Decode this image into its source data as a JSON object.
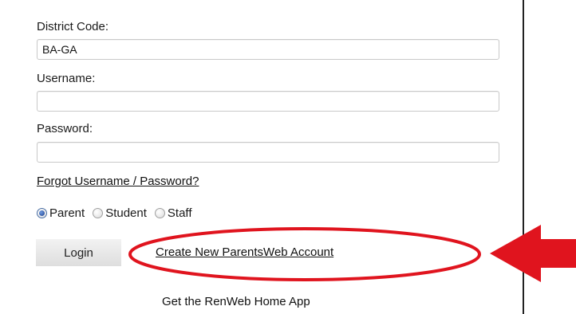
{
  "login_form": {
    "district_code_label": "District Code:",
    "district_code_value": "BA-GA",
    "username_label": "Username:",
    "username_value": "",
    "password_label": "Password:",
    "password_value": "",
    "forgot_link": "Forgot Username / Password?",
    "roles": [
      {
        "label": "Parent",
        "selected": true
      },
      {
        "label": "Student",
        "selected": false
      },
      {
        "label": "Staff",
        "selected": false
      }
    ],
    "login_label": "Login",
    "create_account_link": "Create New ParentsWeb Account",
    "home_app_text": "Get the RenWeb Home App"
  },
  "annotation": {
    "highlight_color": "#e0141e"
  }
}
